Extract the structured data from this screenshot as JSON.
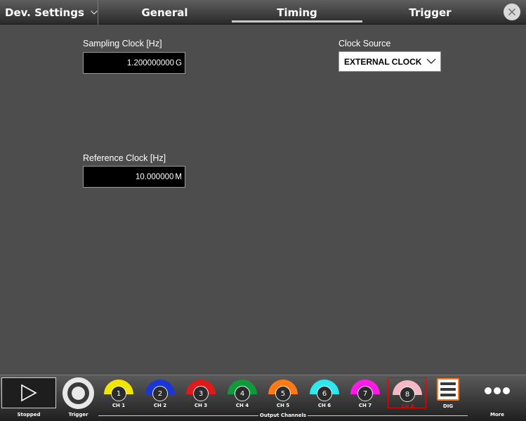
{
  "header": {
    "menu_title": "Dev. Settings",
    "tabs": [
      {
        "label": "General"
      },
      {
        "label": "Timing",
        "active": true
      },
      {
        "label": "Trigger"
      }
    ],
    "close_icon": "close-icon"
  },
  "timing": {
    "sampling_clock": {
      "label": "Sampling Clock [Hz]",
      "value": "1.200000000",
      "unit": "G"
    },
    "clock_source": {
      "label": "Clock Source",
      "value": "EXTERNAL CLOCK"
    },
    "reference_clock": {
      "label": "Reference Clock [Hz]",
      "value": "10.000000",
      "unit": "M"
    }
  },
  "bottom_bar": {
    "run": {
      "label": "Stopped",
      "icon": "play-icon"
    },
    "trigger": {
      "label": "Trigger",
      "icon": "trigger-icon"
    },
    "channels_group_label": "Output Channels",
    "channels": [
      {
        "number": "1",
        "label": "CH 1",
        "color": "#f2e600"
      },
      {
        "number": "2",
        "label": "CH 2",
        "color": "#1a36d6"
      },
      {
        "number": "3",
        "label": "CH 3",
        "color": "#e01a1a"
      },
      {
        "number": "4",
        "label": "CH 4",
        "color": "#0f9a3c"
      },
      {
        "number": "5",
        "label": "CH 5",
        "color": "#ff7a12"
      },
      {
        "number": "6",
        "label": "CH 6",
        "color": "#2ee6ee"
      },
      {
        "number": "7",
        "label": "CH 7",
        "color": "#ff1ae6"
      },
      {
        "number": "8",
        "label": "CH 8",
        "color": "#f7b8c6",
        "selected": true
      }
    ],
    "dig": {
      "label": "DIG",
      "color": "#ff7a1a"
    },
    "more": {
      "label": "More"
    }
  }
}
